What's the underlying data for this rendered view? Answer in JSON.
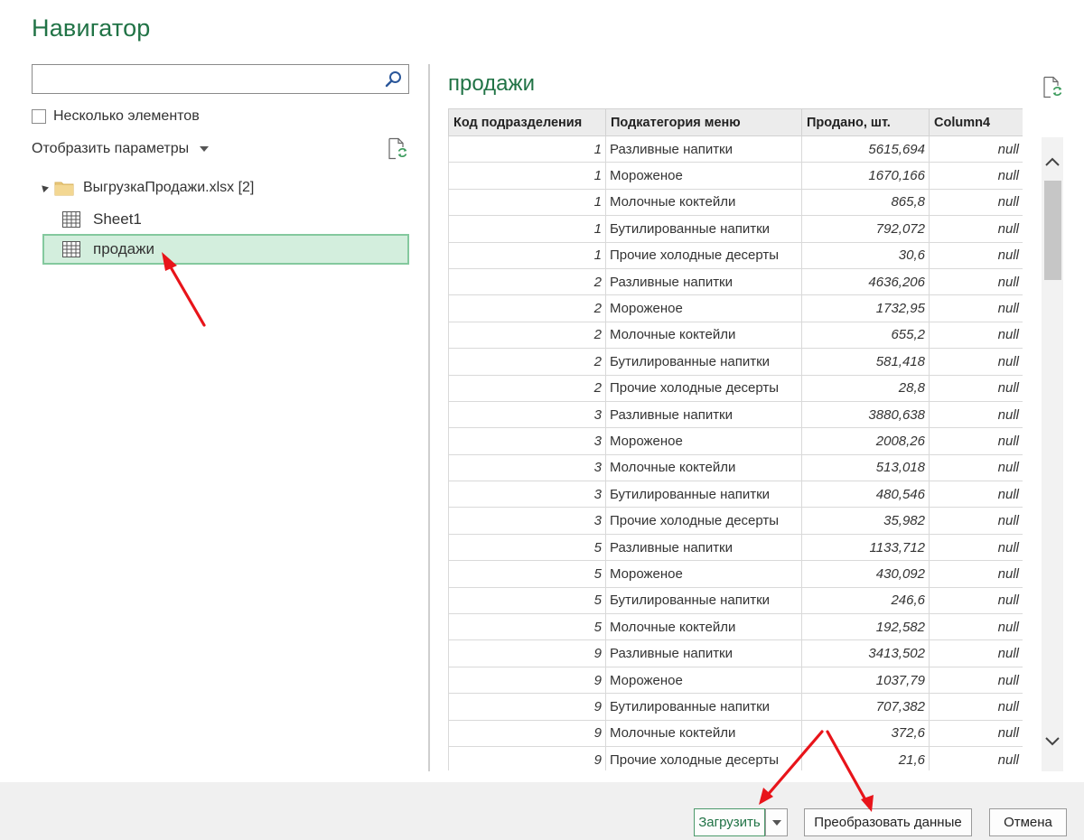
{
  "window": {
    "title": "Навигатор"
  },
  "left_pane": {
    "search": {
      "value": "",
      "placeholder": ""
    },
    "multi_select_label": "Несколько элементов",
    "display_options_label": "Отобразить параметры",
    "tree": {
      "folder_label": "ВыгрузкаПродажи.xlsx [2]",
      "items": [
        {
          "label": "Sheet1",
          "selected": false
        },
        {
          "label": "продажи",
          "selected": true
        }
      ]
    }
  },
  "preview": {
    "title": "продажи",
    "columns": [
      "Код подразделения",
      "Подкатегория меню",
      "Продано, шт.",
      "Column4"
    ],
    "rows": [
      [
        "1",
        "Разливные напитки",
        "5615,694",
        "null"
      ],
      [
        "1",
        "Мороженое",
        "1670,166",
        "null"
      ],
      [
        "1",
        "Молочные коктейли",
        "865,8",
        "null"
      ],
      [
        "1",
        "Бутилированные напитки",
        "792,072",
        "null"
      ],
      [
        "1",
        "Прочие холодные десерты",
        "30,6",
        "null"
      ],
      [
        "2",
        "Разливные напитки",
        "4636,206",
        "null"
      ],
      [
        "2",
        "Мороженое",
        "1732,95",
        "null"
      ],
      [
        "2",
        "Молочные коктейли",
        "655,2",
        "null"
      ],
      [
        "2",
        "Бутилированные напитки",
        "581,418",
        "null"
      ],
      [
        "2",
        "Прочие холодные десерты",
        "28,8",
        "null"
      ],
      [
        "3",
        "Разливные напитки",
        "3880,638",
        "null"
      ],
      [
        "3",
        "Мороженое",
        "2008,26",
        "null"
      ],
      [
        "3",
        "Молочные коктейли",
        "513,018",
        "null"
      ],
      [
        "3",
        "Бутилированные напитки",
        "480,546",
        "null"
      ],
      [
        "3",
        "Прочие холодные десерты",
        "35,982",
        "null"
      ],
      [
        "5",
        "Разливные напитки",
        "1133,712",
        "null"
      ],
      [
        "5",
        "Мороженое",
        "430,092",
        "null"
      ],
      [
        "5",
        "Бутилированные напитки",
        "246,6",
        "null"
      ],
      [
        "5",
        "Молочные коктейли",
        "192,582",
        "null"
      ],
      [
        "9",
        "Разливные напитки",
        "3413,502",
        "null"
      ],
      [
        "9",
        "Мороженое",
        "1037,79",
        "null"
      ],
      [
        "9",
        "Бутилированные напитки",
        "707,382",
        "null"
      ],
      [
        "9",
        "Молочные коктейли",
        "372,6",
        "null"
      ],
      [
        "9",
        "Прочие холодные десерты",
        "21,6",
        "null"
      ]
    ]
  },
  "footer": {
    "load_label": "Загрузить",
    "transform_label": "Преобразовать данные",
    "cancel_label": "Отмена"
  },
  "icons": {
    "search": "search-icon",
    "refresh": "refresh-icon",
    "folder": "folder-icon",
    "table": "table-icon",
    "collapse": "collapse-triangle-icon",
    "scroll_up": "chevron-up-icon",
    "scroll_down": "chevron-down-icon"
  },
  "colors": {
    "accent_green": "#217346",
    "selection_fill": "#d3eedd",
    "selection_border": "#84c99e",
    "annotation_arrow": "#e8141a"
  }
}
